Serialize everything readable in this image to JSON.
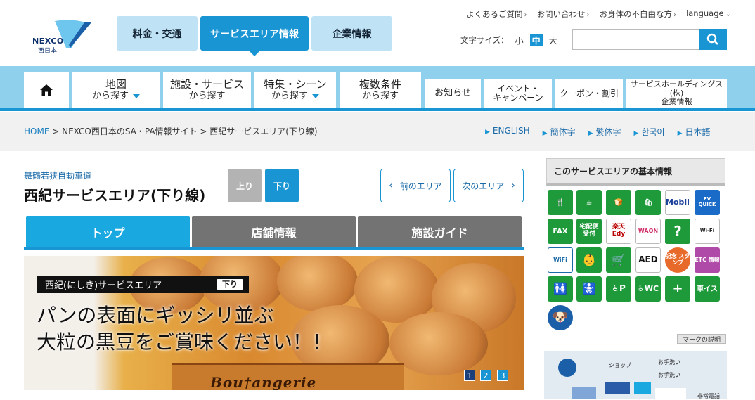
{
  "logo": {
    "name": "NEXCO",
    "sub": "西日本"
  },
  "header_tabs": [
    {
      "label": "料金・交通",
      "active": false
    },
    {
      "label": "サービスエリア情報",
      "active": true
    },
    {
      "label": "企業情報",
      "active": false
    }
  ],
  "top_links": [
    "よくあるご質問",
    "お問い合わせ",
    "お身体の不自由な方",
    "language"
  ],
  "font_size": {
    "label": "文字サイズ：",
    "options": [
      "小",
      "中",
      "大"
    ],
    "selected": "中"
  },
  "search": {
    "placeholder": ""
  },
  "nav": [
    {
      "line1": "地図",
      "line2": "から探す"
    },
    {
      "line1": "施設・サービス",
      "line2": "から探す"
    },
    {
      "line1": "特集・シーン",
      "line2": "から探す"
    },
    {
      "line1": "複数条件",
      "line2": "から探す"
    },
    {
      "line1": "お知らせ",
      "line2": ""
    },
    {
      "line1": "イベント・",
      "line2": "キャンペーン"
    },
    {
      "line1": "クーポン・割引",
      "line2": ""
    },
    {
      "line1": "サービスホールディングス(株)",
      "line2": "企業情報"
    }
  ],
  "breadcrumb": {
    "home": "HOME",
    "sep": " > ",
    "level2": "NEXCO西日本のSA・PA情報サイト",
    "level3": "西紀サービスエリア(下り線)"
  },
  "languages": [
    "ENGLISH",
    "簡体字",
    "繁体字",
    "한국어",
    "日本語"
  ],
  "area": {
    "road": "舞鶴若狭自動車道",
    "title": "西紀サービスエリア(下り線)",
    "up": "上り",
    "down": "下り",
    "prev": "前のエリア",
    "next": "次のエリア"
  },
  "content_tabs": [
    "トップ",
    "店舗情報",
    "施設ガイド"
  ],
  "banner": {
    "label": "西紀(にしき)サービスエリア",
    "dir": "下り",
    "line1": "パンの表面にギッシリ並ぶ",
    "line2": "大粒の黒豆をご賞味ください！！",
    "brand": "Bou†angerie",
    "pages": [
      "1",
      "2",
      "3"
    ]
  },
  "sidebar": {
    "heading": "このサービスエリアの基本情報",
    "icons": [
      {
        "name": "restaurant-icon",
        "label": "🍴"
      },
      {
        "name": "snack-icon",
        "label": "☕"
      },
      {
        "name": "bakery-icon",
        "label": "🍞"
      },
      {
        "name": "shopping-icon",
        "label": "🛍"
      },
      {
        "name": "mobil-icon",
        "label": "Mobil"
      },
      {
        "name": "ev-quick-icon",
        "label": "EV QUICK"
      },
      {
        "name": "fax-icon",
        "label": "FAX"
      },
      {
        "name": "delivery-icon",
        "label": "宅配便 受付"
      },
      {
        "name": "edy-icon",
        "label": "楽天 Edy"
      },
      {
        "name": "waon-icon",
        "label": "WAON"
      },
      {
        "name": "info-icon",
        "label": "?"
      },
      {
        "name": "wifi-sign-icon",
        "label": "Wi-Fi"
      },
      {
        "name": "nexco-wifi-icon",
        "label": "WiFi"
      },
      {
        "name": "nursing-icon",
        "label": "👶"
      },
      {
        "name": "cart-icon",
        "label": "🛒"
      },
      {
        "name": "aed-icon",
        "label": "AED"
      },
      {
        "name": "stamp-icon",
        "label": "記念 スタンプ"
      },
      {
        "name": "etc-icon",
        "label": "ETC 情報"
      },
      {
        "name": "toilet-icon",
        "label": "🚻"
      },
      {
        "name": "baby-seat-icon",
        "label": "🚼"
      },
      {
        "name": "accessible-parking-icon",
        "label": "♿P"
      },
      {
        "name": "accessible-toilet-icon",
        "label": "♿WC"
      },
      {
        "name": "ostomate-icon",
        "label": "+"
      },
      {
        "name": "wheelchair-icon",
        "label": "車イス"
      },
      {
        "name": "dog-icon",
        "label": "🐶"
      }
    ],
    "mark_button": "マークの説明",
    "map_labels": [
      "ショップ",
      "お手洗い",
      "お手洗い",
      "非常電話"
    ]
  }
}
